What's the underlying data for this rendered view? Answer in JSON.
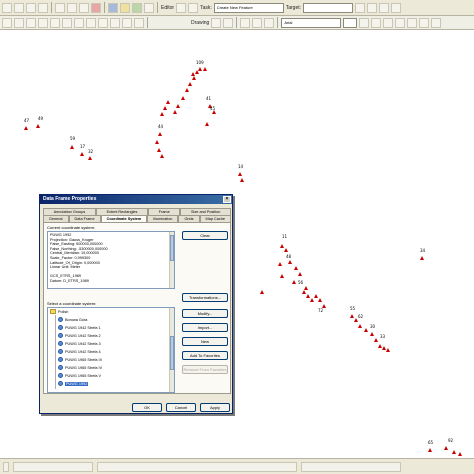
{
  "toolbar": {
    "top": {
      "editor_label": "Editor",
      "task_label": "Task:",
      "task_value": "Create New Feature",
      "target_label": "Target:"
    },
    "bottom": {
      "drawing_label": "Drawing",
      "font_value": "Arial"
    }
  },
  "map": {
    "point_color": "#cc0000",
    "label_color": "#000000",
    "labels": [
      "109",
      "47",
      "49",
      "59",
      "17",
      "32",
      "44",
      "41",
      "45",
      "14",
      "11",
      "48",
      "56",
      "72",
      "55",
      "62",
      "30",
      "33",
      "34",
      "65",
      "92"
    ]
  },
  "dialog": {
    "title": "Data Frame Properties",
    "close_glyph": "×",
    "tabs_row1": [
      "Annotation Groups",
      "Extent Rectangles",
      "Frame",
      "Size and Position"
    ],
    "tabs_row2": [
      "General",
      "Data Frame",
      "Coordinate System",
      "Illumination",
      "Grids",
      "Map Cache"
    ],
    "current_label": "Current coordinate system:",
    "details": [
      "PUWG 1992",
      "Projection: Gauss_Kruger",
      "False_Easting: 500000,000000",
      "False_Northing: -5300000,000000",
      "Central_Meridian: 19,000000",
      "Scale_Factor: 0,999300",
      "Latitude_Of_Origin: 0,000000",
      "Linear Unit: Meter",
      "",
      "GCS_ETRS_1989",
      "Datum: D_ETRS_1989"
    ],
    "clear_label": "Clear",
    "transformations_label": "Transformations...",
    "select_label": "Select a coordinate system:",
    "tree_items": [
      "Polish",
      "Borowa Góra",
      "PUWG 1942 Strefa 1",
      "PUWG 1942 Strefa 2",
      "PUWG 1942 Strefa 3",
      "PUWG 1942 Strefa 4",
      "PUWG 1965 Strefa III",
      "PUWG 1965 Strefa IV",
      "PUWG 1965 Strefa V",
      "PUWG 1992"
    ],
    "modify_label": "Modify...",
    "import_label": "Import...",
    "new_label": "New",
    "add_favorites_label": "Add To Favorites",
    "remove_favorites_label": "Remove From Favorites",
    "ok_label": "OK",
    "cancel_label": "Cancel",
    "apply_label": "Apply"
  }
}
